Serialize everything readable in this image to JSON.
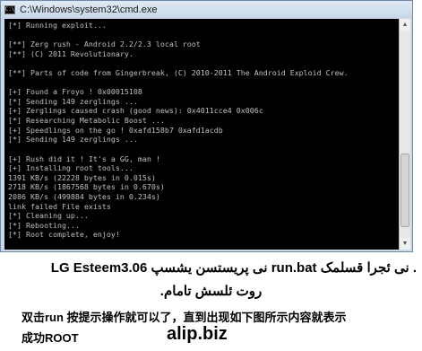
{
  "window": {
    "title": "C:\\Windows\\system32\\cmd.exe",
    "icon_glyph": "C:\\"
  },
  "console_lines": [
    "[*] Running exploit...",
    "",
    "[**] Zerg rush - Android 2.2/2.3 local root",
    "[**] (C) 2011 Revolutionary.",
    "",
    "[**] Parts of code from Gingerbreak, (C) 2010-2011 The Android Exploid Crew.",
    "",
    "[+] Found a Froyo ! 0x00015108",
    "[*] Sending 149 zerglings ...",
    "[+] Zerglings caused crash (good news): 0x4011cce4 0x006c",
    "[*] Researching Metabolic Boost ...",
    "[+] Speedlings on the go ! 0xafd158b7 0xafd1acdb",
    "[*] Sending 149 zerglings ...",
    "",
    "[+] Rush did it ! It's a GG, man !",
    "[+] Installing root tools...",
    "1391 KB/s (22228 bytes in 0.015s)",
    "2718 KB/s (1867568 bytes in 0.670s)",
    "2086 KB/s (499884 bytes in 0.234s)",
    "link failed File exists",
    "[*] Cleaning up...",
    "[*] Rebooting...",
    "[*] Root complete, enjoy!"
  ],
  "caption": {
    "line1": "LG Esteem3.06 نی پریستسن یشسپ run.bat نی ئجرا قسلمک .",
    "line2": "روت ئلسش تامام.",
    "line3": "双击run 按提示操作就可以了，直到出现如下图所示内容就表示",
    "line4": "成功ROOT"
  },
  "watermark": "alip.biz"
}
